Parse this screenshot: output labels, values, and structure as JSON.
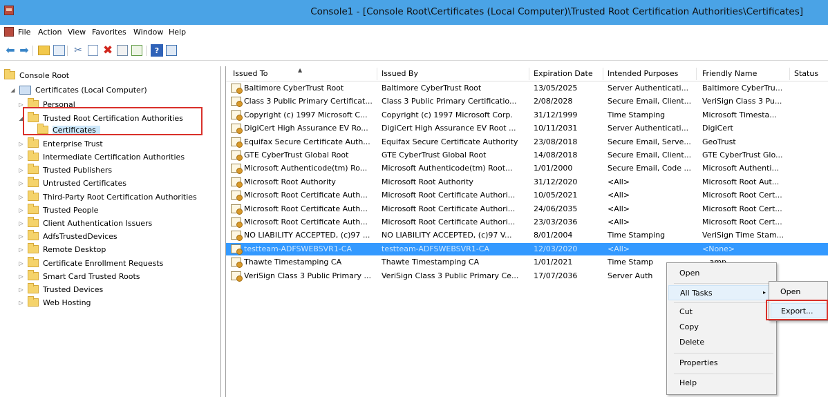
{
  "window": {
    "title": "Console1 - [Console Root\\Certificates (Local Computer)\\Trusted Root Certification Authorities\\Certificates]"
  },
  "menubar": {
    "items": [
      "File",
      "Action",
      "View",
      "Favorites",
      "Window",
      "Help"
    ]
  },
  "toolbar": {
    "icons": [
      "back-arrow-icon",
      "forward-arrow-icon",
      "up-folder-icon",
      "show-tree-icon",
      "cut-icon",
      "copy-icon",
      "delete-icon",
      "properties-icon",
      "export-list-icon",
      "help-icon",
      "view-icon"
    ]
  },
  "tree": {
    "root": "Console Root",
    "computer": "Certificates (Local Computer)",
    "items": [
      "Personal",
      "Trusted Root Certification Authorities",
      "Certificates",
      "Enterprise Trust",
      "Intermediate Certification Authorities",
      "Trusted Publishers",
      "Untrusted Certificates",
      "Third-Party Root Certification Authorities",
      "Trusted People",
      "Client Authentication Issuers",
      "AdfsTrustedDevices",
      "Remote Desktop",
      "Certificate Enrollment Requests",
      "Smart Card Trusted Roots",
      "Trusted Devices",
      "Web Hosting"
    ]
  },
  "list": {
    "columns": [
      "Issued To",
      "Issued By",
      "Expiration Date",
      "Intended Purposes",
      "Friendly Name",
      "Status"
    ],
    "rows": [
      {
        "issued_to": "Baltimore CyberTrust Root",
        "issued_by": "Baltimore CyberTrust Root",
        "expiration": "13/05/2025",
        "purposes": "Server Authenticati...",
        "friendly": "Baltimore CyberTru..."
      },
      {
        "issued_to": "Class 3 Public Primary Certificat...",
        "issued_by": "Class 3 Public Primary Certificatio...",
        "expiration": "2/08/2028",
        "purposes": "Secure Email, Client...",
        "friendly": "VeriSign Class 3 Pu..."
      },
      {
        "issued_to": "Copyright (c) 1997 Microsoft C...",
        "issued_by": "Copyright (c) 1997 Microsoft Corp.",
        "expiration": "31/12/1999",
        "purposes": "Time Stamping",
        "friendly": "Microsoft Timesta..."
      },
      {
        "issued_to": "DigiCert High Assurance EV Ro...",
        "issued_by": "DigiCert High Assurance EV Root ...",
        "expiration": "10/11/2031",
        "purposes": "Server Authenticati...",
        "friendly": "DigiCert"
      },
      {
        "issued_to": "Equifax Secure Certificate Auth...",
        "issued_by": "Equifax Secure Certificate Authority",
        "expiration": "23/08/2018",
        "purposes": "Secure Email, Serve...",
        "friendly": "GeoTrust"
      },
      {
        "issued_to": "GTE CyberTrust Global Root",
        "issued_by": "GTE CyberTrust Global Root",
        "expiration": "14/08/2018",
        "purposes": "Secure Email, Client...",
        "friendly": "GTE CyberTrust Glo..."
      },
      {
        "issued_to": "Microsoft Authenticode(tm) Ro...",
        "issued_by": "Microsoft Authenticode(tm) Root...",
        "expiration": "1/01/2000",
        "purposes": "Secure Email, Code ...",
        "friendly": "Microsoft Authenti..."
      },
      {
        "issued_to": "Microsoft Root Authority",
        "issued_by": "Microsoft Root Authority",
        "expiration": "31/12/2020",
        "purposes": "<All>",
        "friendly": "Microsoft Root Aut..."
      },
      {
        "issued_to": "Microsoft Root Certificate Auth...",
        "issued_by": "Microsoft Root Certificate Authori...",
        "expiration": "10/05/2021",
        "purposes": "<All>",
        "friendly": "Microsoft Root Cert..."
      },
      {
        "issued_to": "Microsoft Root Certificate Auth...",
        "issued_by": "Microsoft Root Certificate Authori...",
        "expiration": "24/06/2035",
        "purposes": "<All>",
        "friendly": "Microsoft Root Cert..."
      },
      {
        "issued_to": "Microsoft Root Certificate Auth...",
        "issued_by": "Microsoft Root Certificate Authori...",
        "expiration": "23/03/2036",
        "purposes": "<All>",
        "friendly": "Microsoft Root Cert..."
      },
      {
        "issued_to": "NO LIABILITY ACCEPTED, (c)97 ...",
        "issued_by": "NO LIABILITY ACCEPTED, (c)97 V...",
        "expiration": "8/01/2004",
        "purposes": "Time Stamping",
        "friendly": "VeriSign Time Stam..."
      },
      {
        "issued_to": "testteam-ADFSWEBSVR1-CA",
        "issued_by": "testteam-ADFSWEBSVR1-CA",
        "expiration": "12/03/2020",
        "purposes": "<All>",
        "friendly": "<None>"
      },
      {
        "issued_to": "Thawte Timestamping CA",
        "issued_by": "Thawte Timestamping CA",
        "expiration": "1/01/2021",
        "purposes": "Time Stamp",
        "friendly": "...amp..."
      },
      {
        "issued_to": "VeriSign Class 3 Public Primary ...",
        "issued_by": "VeriSign Class 3 Public Primary Ce...",
        "expiration": "17/07/2036",
        "purposes": "Server Auth",
        "friendly": ""
      }
    ]
  },
  "context_menu": {
    "items": [
      "Open",
      "All Tasks",
      "Cut",
      "Copy",
      "Delete",
      "Properties",
      "Help"
    ],
    "submenu_arrow": "▸"
  },
  "submenu": {
    "items": [
      "Open",
      "Export..."
    ]
  }
}
